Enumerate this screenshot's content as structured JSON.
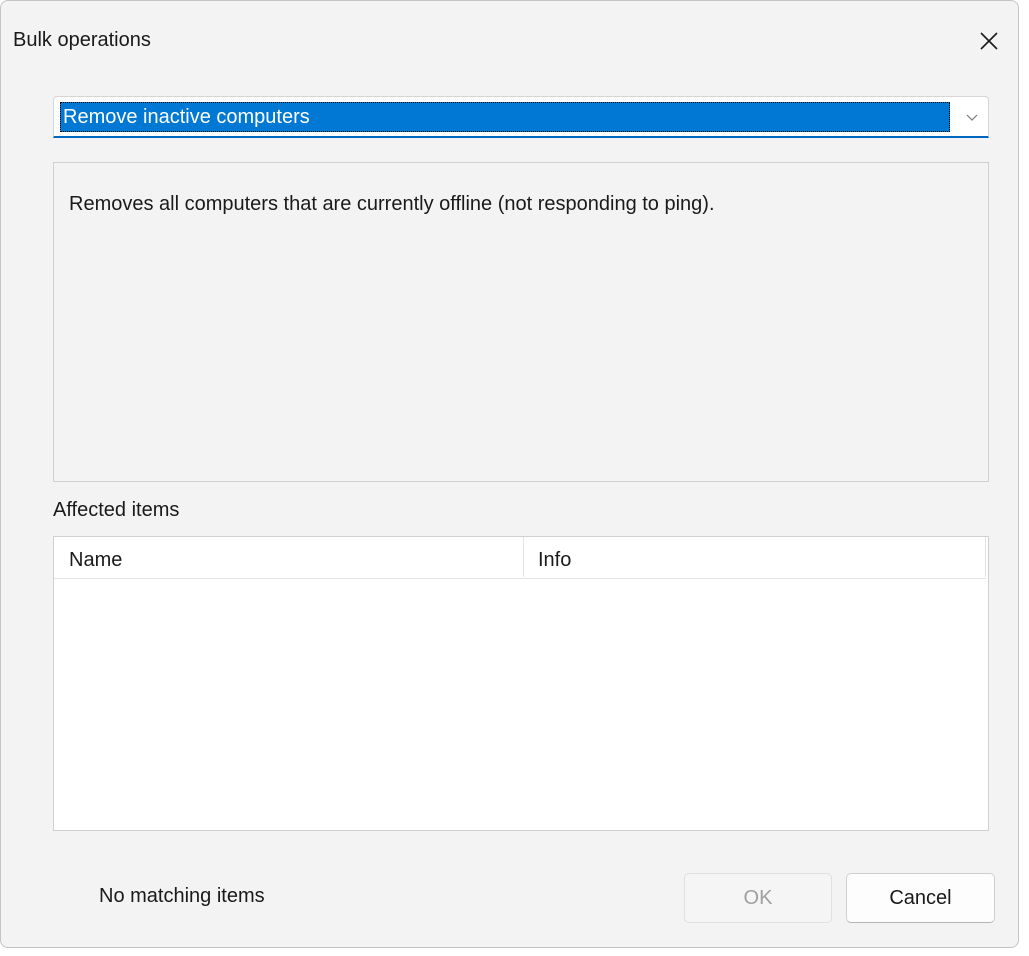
{
  "window": {
    "title": "Bulk operations"
  },
  "operation_select": {
    "selected": "Remove inactive computers"
  },
  "description": {
    "text": "Removes all computers that are currently offline (not responding to ping)."
  },
  "affected": {
    "label": "Affected items",
    "columns": [
      "Name",
      "Info"
    ],
    "rows": []
  },
  "footer": {
    "status": "No matching items",
    "ok_label": "OK",
    "cancel_label": "Cancel",
    "ok_enabled": false
  },
  "colors": {
    "accent": "#0078d4",
    "focus_underline": "#0067c0",
    "dialog_background": "#f3f3f3"
  }
}
